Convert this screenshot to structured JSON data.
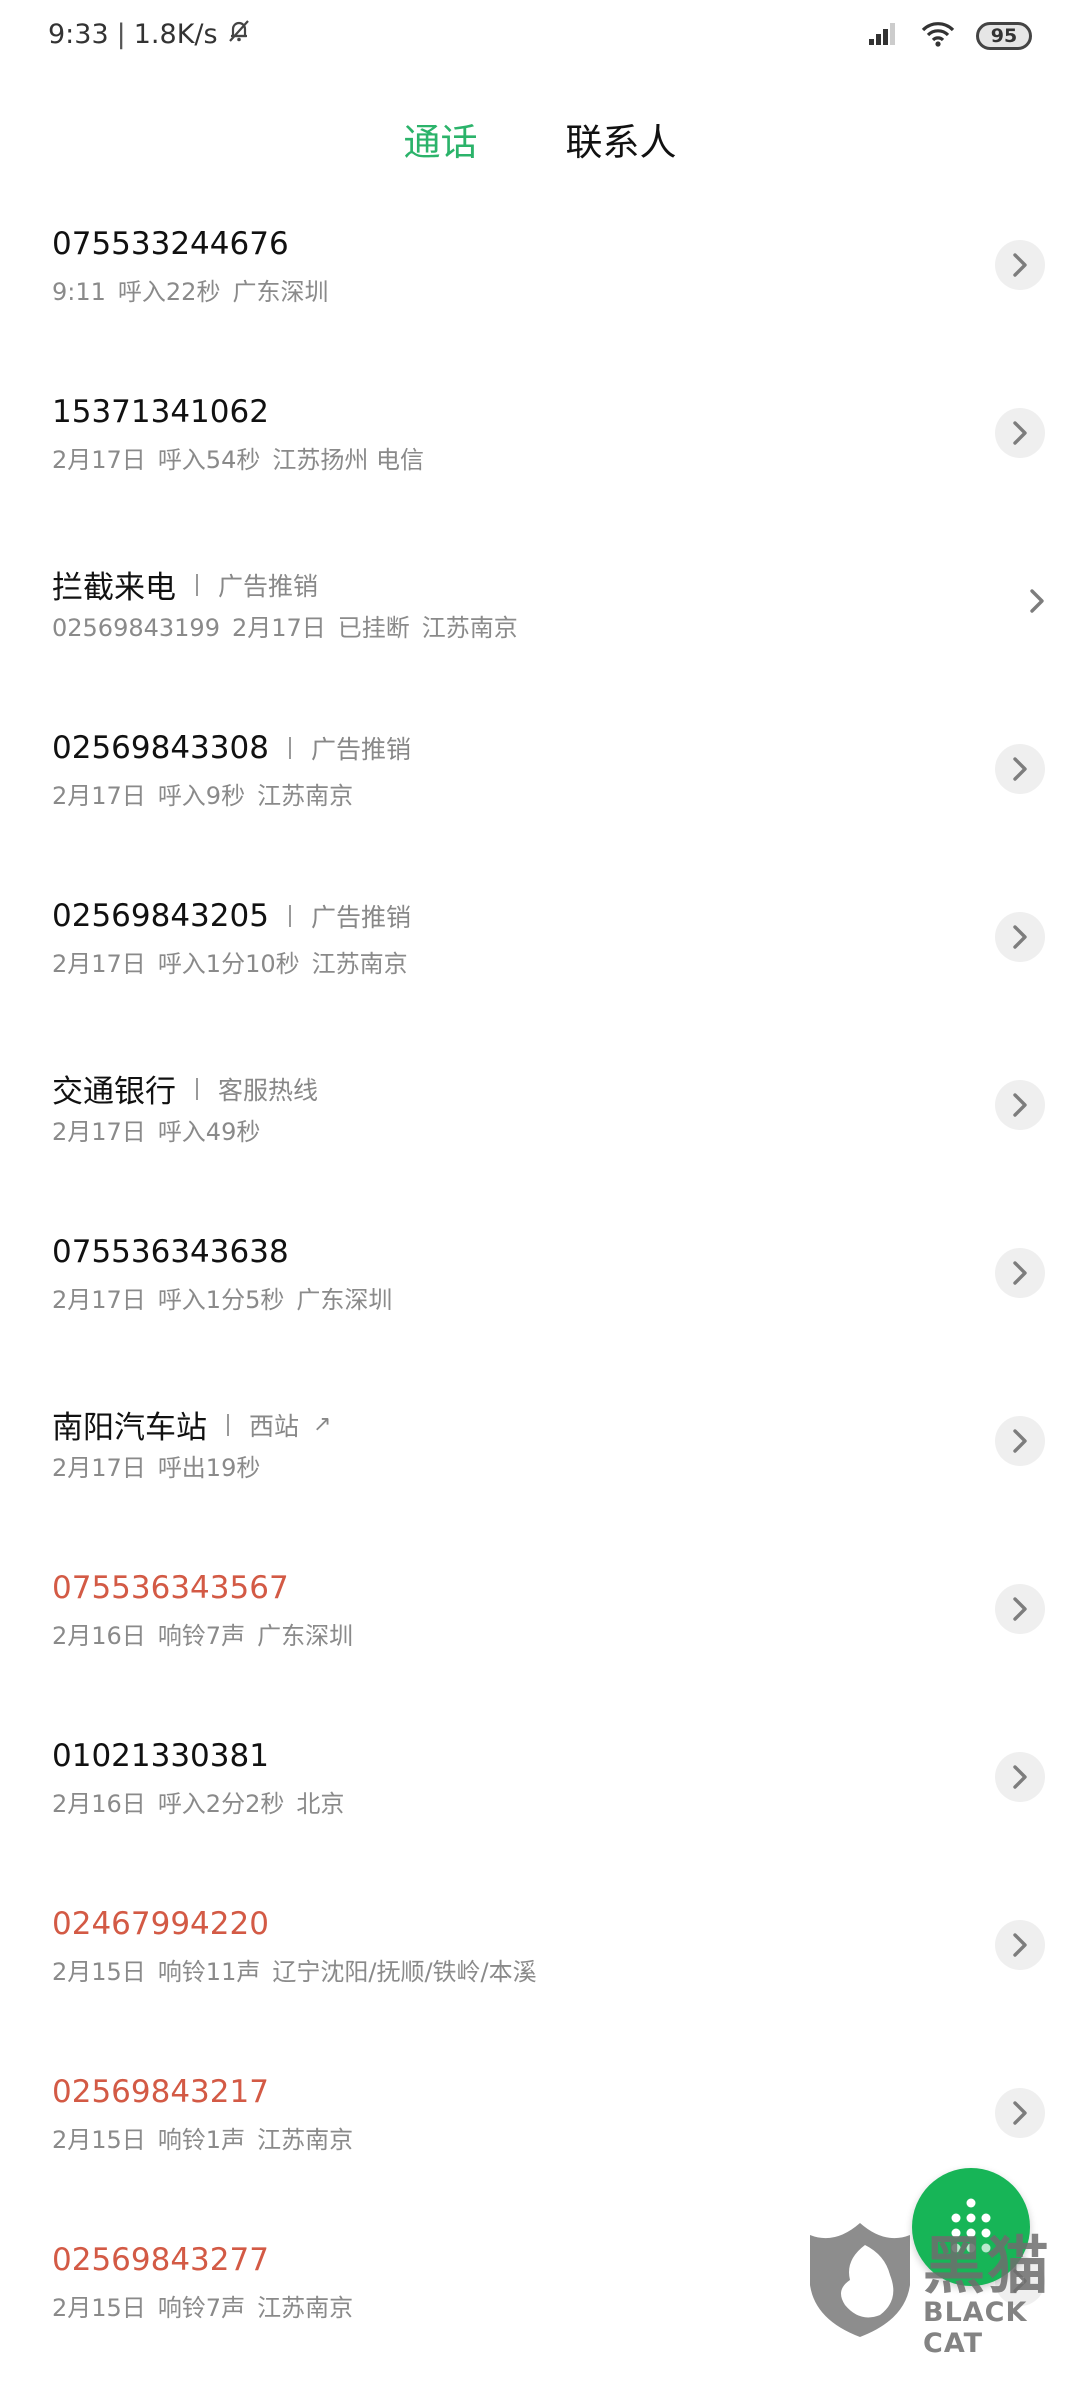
{
  "status_bar": {
    "time": "9:33",
    "separator": "|",
    "net_speed": "1.8K/s",
    "icons": [
      "silent-bell-icon",
      "signal-icon",
      "wifi-icon"
    ],
    "battery": "95"
  },
  "tabs": [
    {
      "label": "通话",
      "active": true
    },
    {
      "label": "联系人",
      "active": false
    }
  ],
  "colors": {
    "accent": "#2bb36a",
    "missed": "#d35a45",
    "fab": "#17b557",
    "secondary_text": "#8a8a8a"
  },
  "calls": [
    {
      "name": "075533244676",
      "tag": "",
      "missed": false,
      "details": [
        "9:11",
        "呼入22秒",
        "广东深圳"
      ]
    },
    {
      "name": "15371341062",
      "tag": "",
      "missed": false,
      "details": [
        "2月17日",
        "呼入54秒",
        "江苏扬州 电信"
      ]
    },
    {
      "name": "拦截来电",
      "tag": "广告推销",
      "missed": false,
      "details": [
        "02569843199",
        "2月17日",
        "已挂断",
        "江苏南京"
      ],
      "chevron_style": "plain"
    },
    {
      "name": "02569843308",
      "tag": "广告推销",
      "missed": false,
      "details": [
        "2月17日",
        "呼入9秒",
        "江苏南京"
      ]
    },
    {
      "name": "02569843205",
      "tag": "广告推销",
      "missed": false,
      "details": [
        "2月17日",
        "呼入1分10秒",
        "江苏南京"
      ]
    },
    {
      "name": "交通银行",
      "tag": "客服热线",
      "missed": false,
      "details": [
        "2月17日",
        "呼入49秒"
      ]
    },
    {
      "name": "075536343638",
      "tag": "",
      "missed": false,
      "details": [
        "2月17日",
        "呼入1分5秒",
        "广东深圳"
      ]
    },
    {
      "name": "南阳汽车站",
      "tag": "西站",
      "tag_arrow": "↗",
      "missed": false,
      "details": [
        "2月17日",
        "呼出19秒"
      ]
    },
    {
      "name": "075536343567",
      "tag": "",
      "missed": true,
      "details": [
        "2月16日",
        "响铃7声",
        "广东深圳"
      ]
    },
    {
      "name": "01021330381",
      "tag": "",
      "missed": false,
      "details": [
        "2月16日",
        "呼入2分2秒",
        "北京"
      ]
    },
    {
      "name": "02467994220",
      "tag": "",
      "missed": true,
      "details": [
        "2月15日",
        "响铃11声",
        "辽宁沈阳/抚顺/铁岭/本溪"
      ]
    },
    {
      "name": "02569843217",
      "tag": "",
      "missed": true,
      "details": [
        "2月15日",
        "响铃1声",
        "江苏南京"
      ]
    },
    {
      "name": "02569843277",
      "tag": "",
      "missed": true,
      "details": [
        "2月15日",
        "响铃7声",
        "江苏南京"
      ]
    }
  ],
  "fab": {
    "icon": "dialpad-icon"
  },
  "watermark": {
    "title": "黑猫",
    "subtitle": "BLACK CAT"
  }
}
